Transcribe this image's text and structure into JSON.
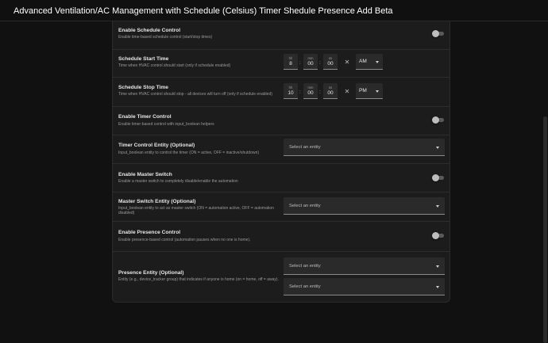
{
  "header": {
    "title": "Advanced Ventilation/AC Management with Schedule (Celsius) Timer Shedule Presence Add Beta"
  },
  "rows": {
    "schedule_control": {
      "title": "Enable Schedule Control",
      "desc": "Enable time-based schedule control (start/stop times)",
      "enabled": false
    },
    "start_time": {
      "title": "Schedule Start Time",
      "desc": "Time when HVAC control should start (only if schedule enabled)",
      "hh_label": "hh",
      "mm_label": "mm",
      "ss_label": "ss",
      "hh": "8",
      "mm": "00",
      "ss": "00",
      "ampm": "AM"
    },
    "stop_time": {
      "title": "Schedule Stop Time",
      "desc": "Time when HVAC control should stop - all devices will turn off (only if schedule enabled)",
      "hh_label": "hh",
      "mm_label": "mm",
      "ss_label": "ss",
      "hh": "10",
      "mm": "00",
      "ss": "00",
      "ampm": "PM"
    },
    "timer_control": {
      "title": "Enable Timer Control",
      "desc": "Enable timer-based control with input_boolean helpers",
      "enabled": false
    },
    "timer_entity": {
      "title": "Timer Control Entity (Optional)",
      "desc": "Input_boolean entity to control the timer (ON = active, OFF = inactive/shutdown)",
      "placeholder": "Select an entity"
    },
    "master_switch": {
      "title": "Enable Master Switch",
      "desc": "Enable a master switch to completely disable/enable the automation",
      "enabled": false
    },
    "master_entity": {
      "title": "Master Switch Entity (Optional)",
      "desc": "Input_boolean entity to act as master switch (ON = automation active, OFF = automation disabled)",
      "placeholder": "Select an entity"
    },
    "presence_control": {
      "title": "Enable Presence Control",
      "desc": "Enable presence-based control (automation pauses when no one is home).",
      "enabled": false
    },
    "presence_entity": {
      "title": "Presence Entity (Optional)",
      "desc": "Entity (e.g., device_tracker group) that indicates if anyone is home (on = home, off = away).",
      "placeholder_1": "Select an entity",
      "placeholder_2": "Select an entity"
    }
  },
  "colors": {
    "background": "#111111",
    "card": "#1c1c1c",
    "field": "#2a2a2a",
    "text": "#e1e1e1",
    "muted": "#9a9a9a"
  }
}
